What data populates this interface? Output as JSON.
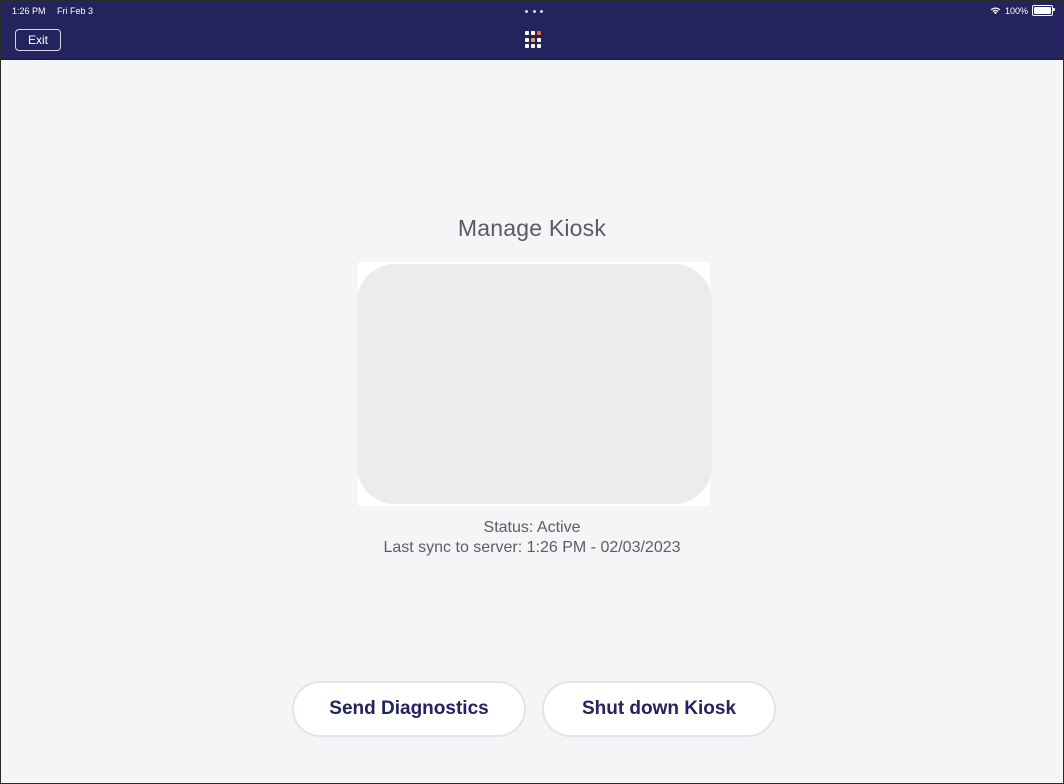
{
  "status_bar": {
    "time": "1:26 PM",
    "date": "Fri Feb 3",
    "battery": "100%",
    "battery_level": 1.0,
    "icons": [
      "wifi-icon",
      "battery-icon",
      "multitask-dots-icon"
    ]
  },
  "header": {
    "exit_label": "Exit",
    "apps_icon": "grid-apps-icon",
    "background_color": "#23235e",
    "apps_icon_colors": [
      "#ffffff",
      "#ffffff",
      "#e86a4a",
      "#ffffff",
      "#f0a030",
      "#ffffff",
      "#ffffff",
      "#ffffff",
      "#ffffff"
    ]
  },
  "main": {
    "title": "Manage Kiosk",
    "status_text": "Status: Active",
    "sync_text": "Last sync to server: 1:26 PM - 02/03/2023"
  },
  "actions": {
    "send_diagnostics_label": "Send Diagnostics",
    "shutdown_label": "Shut down Kiosk",
    "accent_color": "#23235e"
  }
}
